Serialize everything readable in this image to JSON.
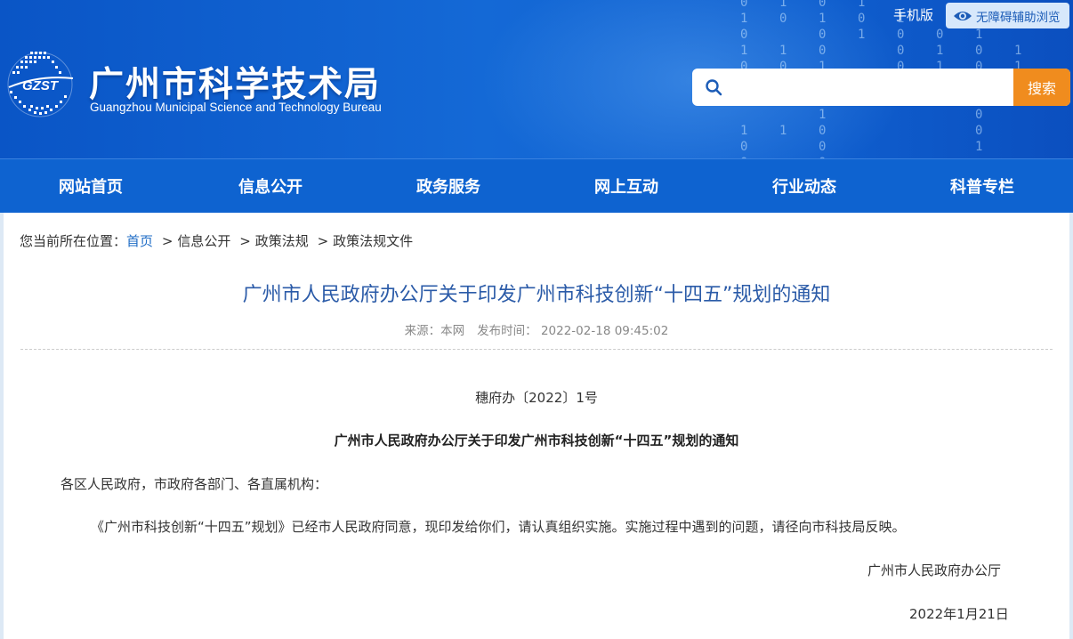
{
  "header": {
    "title": "广州市科学技术局",
    "subtitle": "Guangzhou Municipal Science and Technology Bureau",
    "logo_text": "GZST",
    "mobile_label": "手机版",
    "accessibility_label": "无障碍辅助浏览",
    "search": {
      "placeholder": "",
      "value": "",
      "button_label": "搜索"
    },
    "colors": {
      "banner": "#0e63d0",
      "search_button": "#f08c1e"
    }
  },
  "nav": {
    "items": [
      {
        "label": "网站首页"
      },
      {
        "label": "信息公开"
      },
      {
        "label": "政务服务"
      },
      {
        "label": "网上互动"
      },
      {
        "label": "行业动态"
      },
      {
        "label": "科普专栏"
      }
    ]
  },
  "breadcrumb": {
    "prefix": "您当前所在位置：",
    "home": "首页",
    "separator": ">",
    "items": [
      "信息公开",
      "政策法规",
      "政策法规文件"
    ]
  },
  "article": {
    "title": "广州市人民政府办公厅关于印发广州市科技创新“十四五”规划的通知",
    "source_label": "来源：本网",
    "publish_label": "发布时间：",
    "publish_time": "2022-02-18 09:45:02",
    "doc_number": "穗府办〔2022〕1号",
    "heading": "广州市人民政府办公厅关于印发广州市科技创新“十四五”规划的通知",
    "addressee": "各区人民政府，市政府各部门、各直属机构：",
    "paragraph": "《广州市科技创新“十四五”规划》已经市人民政府同意，现印发给你们，请认真组织实施。实施过程中遇到的问题，请径向市科技局反映。",
    "signature": "广州市人民政府办公厅",
    "date": "2022年1月21日"
  }
}
